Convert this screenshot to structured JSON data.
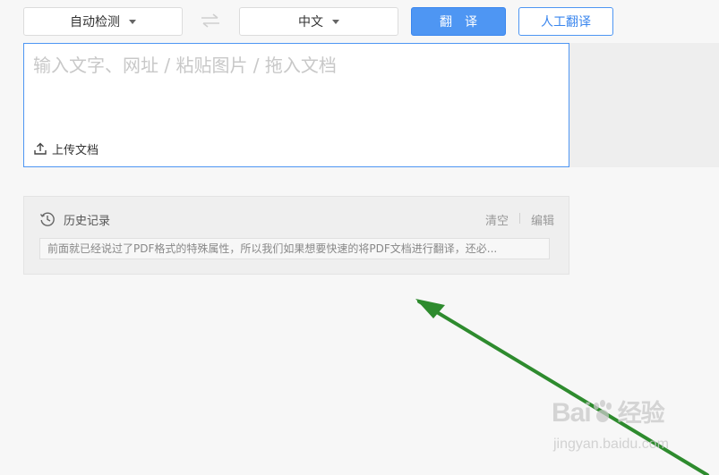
{
  "toolbar": {
    "source_language": "自动检测",
    "target_language": "中文",
    "translate_label": "翻译",
    "human_translate_label": "人工翻译"
  },
  "input": {
    "placeholder": "输入文字、网址 / 粘贴图片 / 拖入文档",
    "value": "",
    "upload_label": "上传文档"
  },
  "history": {
    "title": "历史记录",
    "clear_label": "清空",
    "edit_label": "编辑",
    "records": [
      "前面就已经说过了PDF格式的特殊属性，所以我们如果想要快速的将PDF文档进行翻译，还必..."
    ]
  },
  "annotation": {
    "arrow_color": "#2e8b2e"
  },
  "watermark": {
    "logo": "Bai",
    "logo_suffix": "经验",
    "url": "jingyan.baidu.com"
  },
  "colors": {
    "accent": "#4e96f3",
    "background": "#f7f7f7"
  }
}
